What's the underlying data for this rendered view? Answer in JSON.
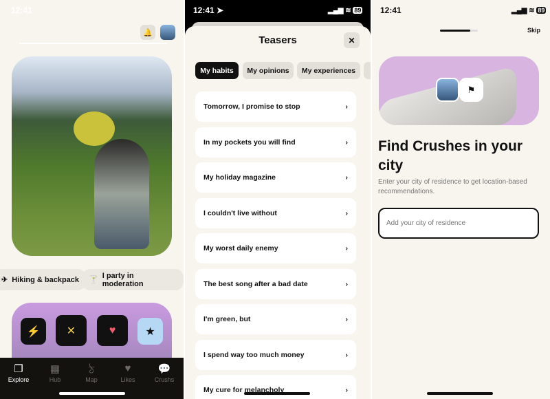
{
  "explore": {
    "status_time": "12:41",
    "chips": [
      {
        "icon": "plane-icon",
        "label": "Hiking & backpack"
      },
      {
        "icon": "party-icon",
        "label": "I party in moderation"
      }
    ],
    "actions": [
      {
        "name": "boost",
        "glyph": "⚡",
        "color": "#e8553a"
      },
      {
        "name": "pass",
        "glyph": "✕",
        "color": "#f0d048"
      },
      {
        "name": "like",
        "glyph": "♥",
        "color": "#f25a6e"
      },
      {
        "name": "superlike",
        "glyph": "★",
        "color": "#111111"
      }
    ],
    "tabs": [
      {
        "label": "Explore",
        "glyph": "❐"
      },
      {
        "label": "Hub",
        "glyph": "▦"
      },
      {
        "label": "Map",
        "glyph": "ঠ"
      },
      {
        "label": "Likes",
        "glyph": "♥"
      },
      {
        "label": "Crushs",
        "glyph": "💬"
      }
    ],
    "active_tab": "Explore"
  },
  "teasers": {
    "status_time": "12:41",
    "battery": "89",
    "title": "Teasers",
    "close_glyph": "✕",
    "categories": [
      "My habits",
      "My opinions",
      "My experiences"
    ],
    "active_category": "My habits",
    "items": [
      "Tomorrow, I promise to stop",
      "In my pockets you will find",
      "My holiday magazine",
      "I couldn't live without",
      "My worst daily enemy",
      "The best song after a bad date",
      "I'm green, but",
      "I spend way too much money",
      "My cure for melancholy"
    ]
  },
  "onboarding": {
    "status_time": "12:41",
    "battery": "89",
    "progress": 0.8,
    "skip": "Skip",
    "heading": "Find Crushes in your city",
    "subtitle": "Enter your city of residence to get location-based recommendations.",
    "input_placeholder": "Add your city of residence"
  }
}
